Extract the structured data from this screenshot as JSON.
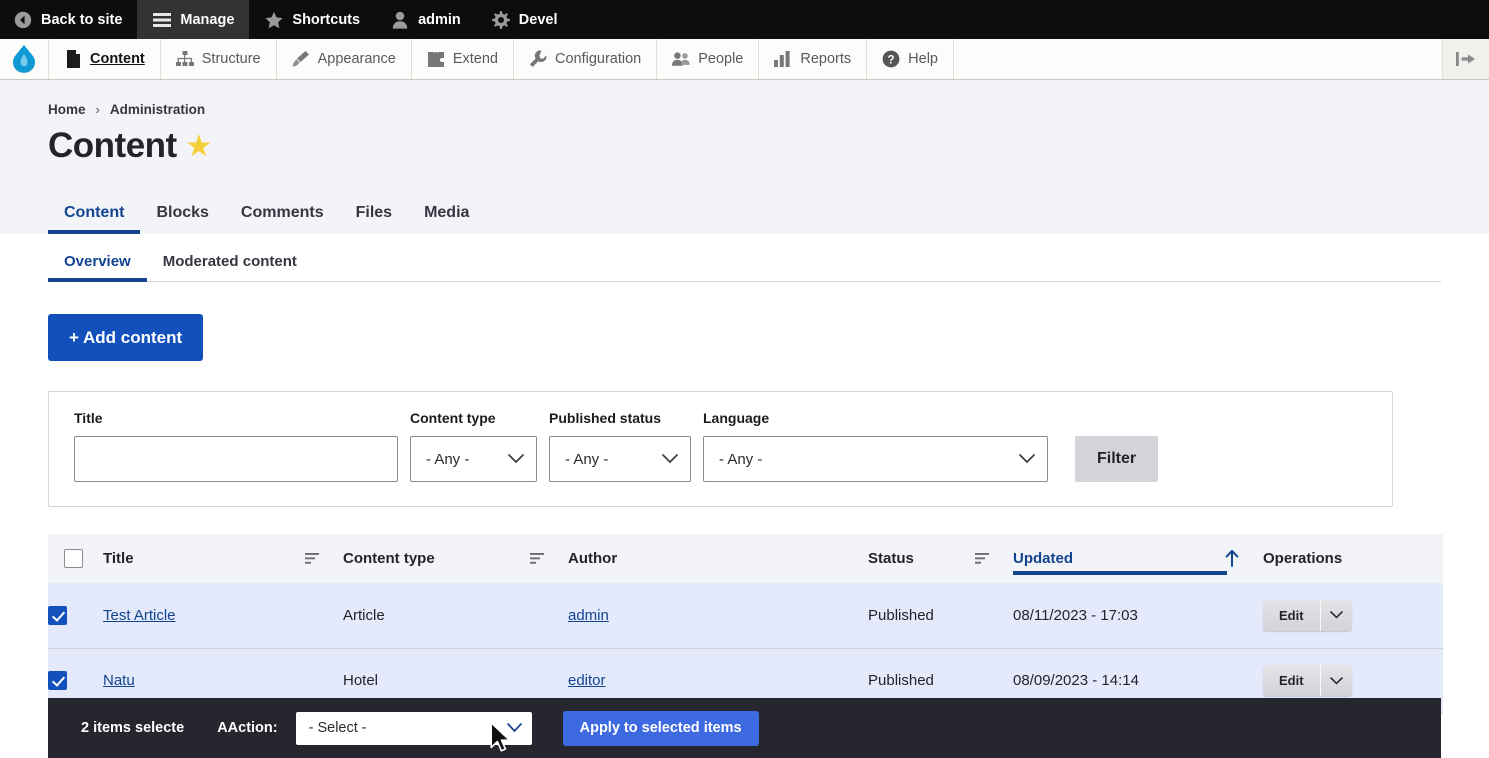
{
  "toolbar": {
    "items": [
      {
        "label": "Back to site",
        "icon": "back-arrow-icon",
        "active": false
      },
      {
        "label": "Manage",
        "icon": "hamburger-icon",
        "active": true
      },
      {
        "label": "Shortcuts",
        "icon": "star-icon",
        "active": false
      },
      {
        "label": "admin",
        "icon": "user-icon",
        "active": false
      },
      {
        "label": "Devel",
        "icon": "gear-icon",
        "active": false
      }
    ]
  },
  "menu": {
    "logo_alt": "drupal-logo",
    "items": [
      {
        "label": "Content",
        "icon": "page-icon",
        "active": true
      },
      {
        "label": "Structure",
        "icon": "sitemap-icon",
        "active": false
      },
      {
        "label": "Appearance",
        "icon": "paintbrush-icon",
        "active": false
      },
      {
        "label": "Extend",
        "icon": "puzzle-icon",
        "active": false
      },
      {
        "label": "Configuration",
        "icon": "wrench-icon",
        "active": false
      },
      {
        "label": "People",
        "icon": "people-icon",
        "active": false
      },
      {
        "label": "Reports",
        "icon": "bar-chart-icon",
        "active": false
      },
      {
        "label": "Help",
        "icon": "question-circle-icon",
        "active": false
      }
    ],
    "orientation_toggle": "vertical-orientation-icon"
  },
  "breadcrumb": {
    "home": "Home",
    "separator": "›",
    "current": "Administration"
  },
  "page": {
    "title": "Content",
    "shortcut_star": "★"
  },
  "primary_tabs": [
    {
      "label": "Content",
      "active": true
    },
    {
      "label": "Blocks",
      "active": false
    },
    {
      "label": "Comments",
      "active": false
    },
    {
      "label": "Files",
      "active": false
    },
    {
      "label": "Media",
      "active": false
    }
  ],
  "secondary_tabs": [
    {
      "label": "Overview",
      "active": true
    },
    {
      "label": "Moderated content",
      "active": false
    }
  ],
  "actions": {
    "add_content": "+ Add content"
  },
  "filters": {
    "title": {
      "label": "Title",
      "value": "",
      "placeholder": ""
    },
    "content_type": {
      "label": "Content type",
      "value": "- Any -"
    },
    "published_status": {
      "label": "Published status",
      "value": "- Any -"
    },
    "language": {
      "label": "Language",
      "value": "- Any -"
    },
    "filter_button": "Filter"
  },
  "table": {
    "columns": [
      {
        "key": "check",
        "label": "",
        "sortable": false
      },
      {
        "key": "title",
        "label": "Title",
        "sortable": true,
        "sorted": false
      },
      {
        "key": "type",
        "label": "Content type",
        "sortable": true,
        "sorted": false
      },
      {
        "key": "author",
        "label": "Author",
        "sortable": false,
        "sorted": false
      },
      {
        "key": "status",
        "label": "Status",
        "sortable": true,
        "sorted": false
      },
      {
        "key": "updated",
        "label": "Updated",
        "sortable": true,
        "sorted": true,
        "direction": "asc"
      },
      {
        "key": "ops",
        "label": "Operations",
        "sortable": false
      }
    ],
    "select_all_checked": false,
    "rows": [
      {
        "checked": true,
        "title": "Test Article",
        "content_type": "Article",
        "author": "admin",
        "status": "Published",
        "updated": "08/11/2023 - 17:03",
        "operation": "Edit"
      },
      {
        "checked": true,
        "title": "Natu",
        "content_type": "Hotel",
        "author": "editor",
        "status": "Published",
        "updated": "08/09/2023 - 14:14",
        "operation": "Edit"
      }
    ]
  },
  "action_bar": {
    "count_text": "2 items selecte",
    "action_label": "AAction:",
    "action_value": "- Select -",
    "apply_button": "Apply to selected items"
  },
  "colors": {
    "brand_blue": "#1350bb",
    "link_blue": "#12448f",
    "apply_blue": "#3e6ae1",
    "header_band": "#f3f4f7",
    "row_selected": "#e4eafb",
    "action_bar_bg": "#26272e",
    "toolbar_black": "#0d0d0d",
    "star_gold": "#f5cf3c"
  }
}
